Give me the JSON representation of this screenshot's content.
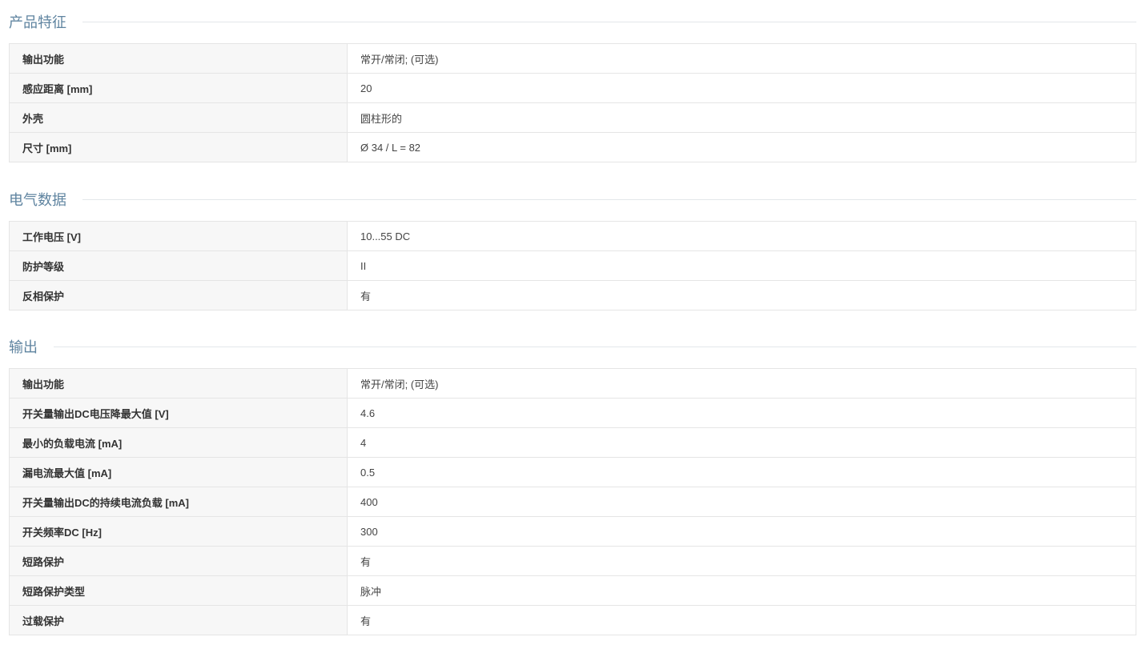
{
  "sections": [
    {
      "title": "产品特征",
      "rows": [
        {
          "label": "输出功能",
          "value": "常开/常闭; (可选)"
        },
        {
          "label": "感应距离 [mm]",
          "value": "20"
        },
        {
          "label": "外壳",
          "value": "圆柱形的"
        },
        {
          "label": "尺寸 [mm]",
          "value": "Ø 34 / L = 82"
        }
      ]
    },
    {
      "title": "电气数据",
      "rows": [
        {
          "label": "工作电压 [V]",
          "value": "10...55 DC"
        },
        {
          "label": "防护等级",
          "value": "II"
        },
        {
          "label": "反相保护",
          "value": "有"
        }
      ]
    },
    {
      "title": "输出",
      "rows": [
        {
          "label": "输出功能",
          "value": "常开/常闭; (可选)"
        },
        {
          "label": "开关量输出DC电压降最大值 [V]",
          "value": "4.6"
        },
        {
          "label": "最小的负载电流 [mA]",
          "value": "4"
        },
        {
          "label": "漏电流最大值 [mA]",
          "value": "0.5"
        },
        {
          "label": "开关量输出DC的持续电流负载 [mA]",
          "value": "400"
        },
        {
          "label": "开关频率DC [Hz]",
          "value": "300"
        },
        {
          "label": "短路保护",
          "value": "有"
        },
        {
          "label": "短路保护类型",
          "value": "脉冲"
        },
        {
          "label": "过载保护",
          "value": "有"
        }
      ]
    }
  ]
}
